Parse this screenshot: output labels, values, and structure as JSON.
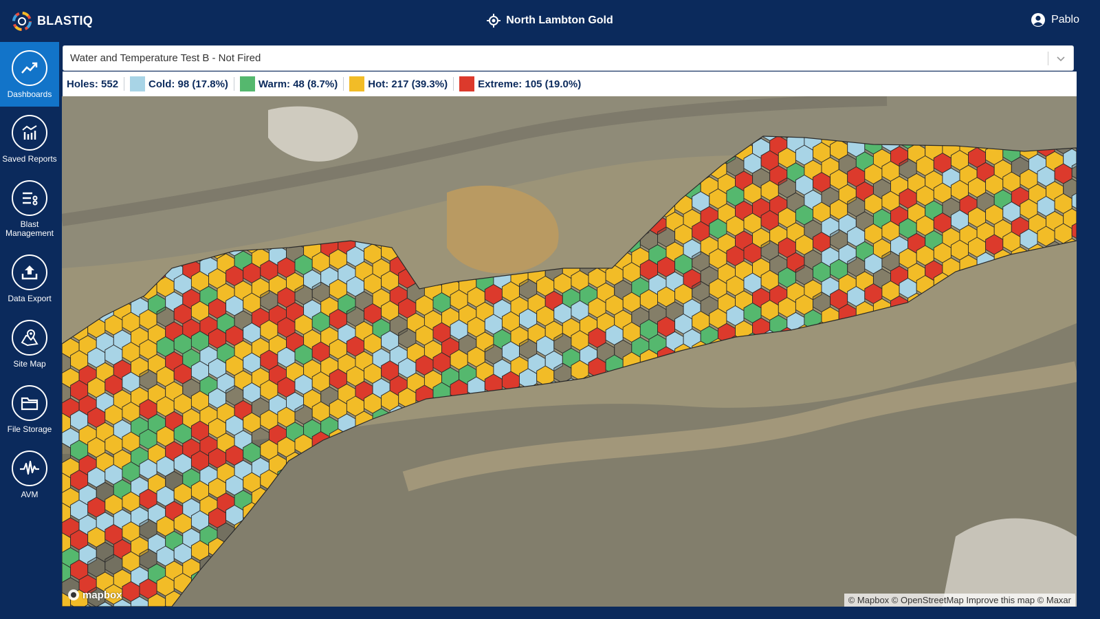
{
  "app": {
    "name": "BLASTIQ"
  },
  "header": {
    "site_name": "North Lambton Gold",
    "user_name": "Pablo"
  },
  "sidebar": {
    "items": [
      {
        "label_lines": [
          "Dashboards"
        ],
        "icon": "trend-line-icon",
        "active": true
      },
      {
        "label_lines": [
          "Saved Reports"
        ],
        "icon": "report-chart-icon",
        "active": false
      },
      {
        "label_lines": [
          "Blast",
          "Management"
        ],
        "icon": "list-settings-icon",
        "active": false
      },
      {
        "label_lines": [
          "Data Export"
        ],
        "icon": "upload-tray-icon",
        "active": false
      },
      {
        "label_lines": [
          "Site Map"
        ],
        "icon": "map-pin-icon",
        "active": false
      },
      {
        "label_lines": [
          "File Storage"
        ],
        "icon": "folder-icon",
        "active": false
      },
      {
        "label_lines": [
          "AVM"
        ],
        "icon": "waveform-icon",
        "active": false
      }
    ]
  },
  "report_select": {
    "value": "Water and Temperature Test B - Not Fired"
  },
  "legend": {
    "holes": "Holes: 552",
    "items": [
      {
        "label": "Cold: 98 (17.8%)",
        "color": "#a8d4e6"
      },
      {
        "label": "Warm: 48 (8.7%)",
        "color": "#55b86e"
      },
      {
        "label": "Hot: 217 (39.3%)",
        "color": "#f2bc27"
      },
      {
        "label": "Extreme: 105 (19.0%)",
        "color": "#dc3a2c"
      }
    ]
  },
  "map": {
    "attribution": "© Mapbox © OpenStreetMap Improve this map © Maxar",
    "logo_text": "mapbox"
  }
}
